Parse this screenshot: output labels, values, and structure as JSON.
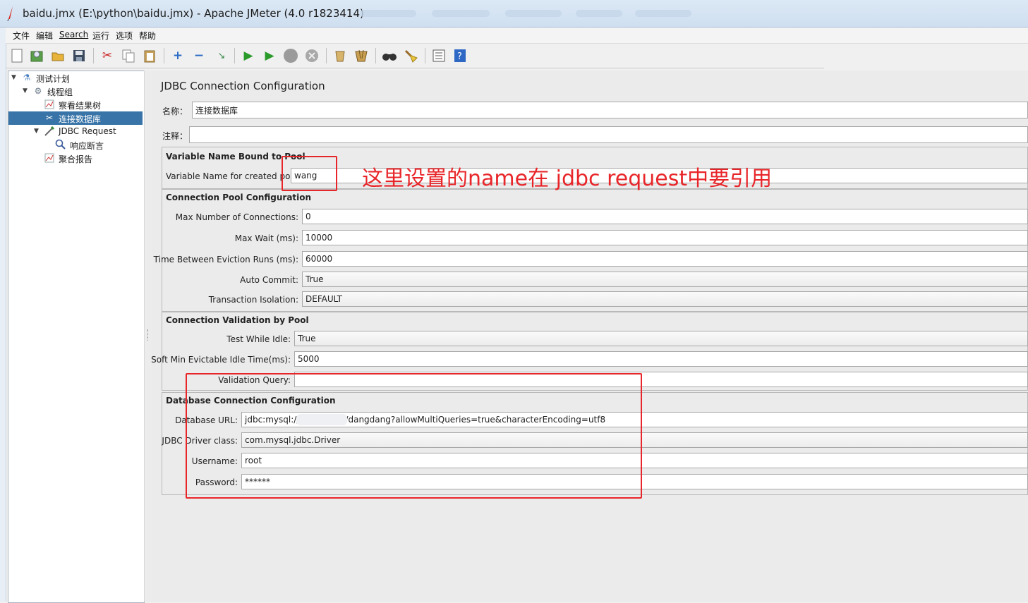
{
  "window": {
    "title": "baidu.jmx (E:\\python\\baidu.jmx) - Apache JMeter (4.0 r1823414)"
  },
  "menu": [
    "文件",
    "编辑",
    "Search",
    "运行",
    "选项",
    "帮助"
  ],
  "toolbar": {
    "icons": [
      "new-icon",
      "templates-icon",
      "open-icon",
      "save-icon",
      "cut-icon",
      "copy-icon",
      "paste-icon",
      "expand-icon",
      "collapse-icon",
      "toggle-icon",
      "start-icon",
      "start-no-pause-icon",
      "stop-icon",
      "shutdown-icon",
      "clear-icon",
      "clear-all-icon",
      "search-icon",
      "reset-search-icon",
      "function-helper-icon",
      "help-icon"
    ]
  },
  "tree": {
    "items": [
      {
        "label": "测试计划",
        "icon": "test-plan-icon"
      },
      {
        "label": "线程组",
        "icon": "thread-group-icon"
      },
      {
        "label": "察看结果树",
        "icon": "listener-icon"
      },
      {
        "label": "连接数据库",
        "icon": "config-icon"
      },
      {
        "label": "JDBC Request",
        "icon": "sampler-icon"
      },
      {
        "label": "响应断言",
        "icon": "assertion-icon"
      },
      {
        "label": "聚合报告",
        "icon": "report-icon"
      }
    ]
  },
  "config": {
    "title": "JDBC Connection Configuration",
    "name_label": "名称：",
    "name_value": "连接数据库",
    "comment_label": "注释：",
    "comment_value": "",
    "var_section": "Variable Name Bound to Pool",
    "var_label": "Variable Name for created pool:",
    "var_value": "wang",
    "pool_section": "Connection Pool Configuration",
    "max_conn_label": "Max Number of Connections:",
    "max_conn_value": "0",
    "max_wait_label": "Max Wait (ms):",
    "max_wait_value": "10000",
    "eviction_label": "Time Between Eviction Runs (ms):",
    "eviction_value": "60000",
    "auto_commit_label": "Auto Commit:",
    "auto_commit_value": "True",
    "isolation_label": "Transaction Isolation:",
    "isolation_value": "DEFAULT",
    "validation_section": "Connection Validation by Pool",
    "test_idle_label": "Test While Idle:",
    "test_idle_value": "True",
    "soft_min_label": "Soft Min Evictable Idle Time(ms):",
    "soft_min_value": "5000",
    "validation_query_label": "Validation Query:",
    "validation_query_value": "",
    "db_section": "Database Connection Configuration",
    "db_url_label": "Database URL:",
    "db_url_value": "jdbc:mysql://4.  .  .  :3306/dangdang?allowMultiQueries=true&characterEncoding=utf8",
    "driver_label": "JDBC Driver class:",
    "driver_value": "com.mysql.jdbc.Driver",
    "username_label": "Username:",
    "username_value": "root",
    "password_label": "Password:",
    "password_value": "******"
  },
  "annotation": "这里设置的name在 jdbc request中要引用",
  "colors": {
    "annotation": "#e8262a",
    "selection": "#3874a8"
  }
}
